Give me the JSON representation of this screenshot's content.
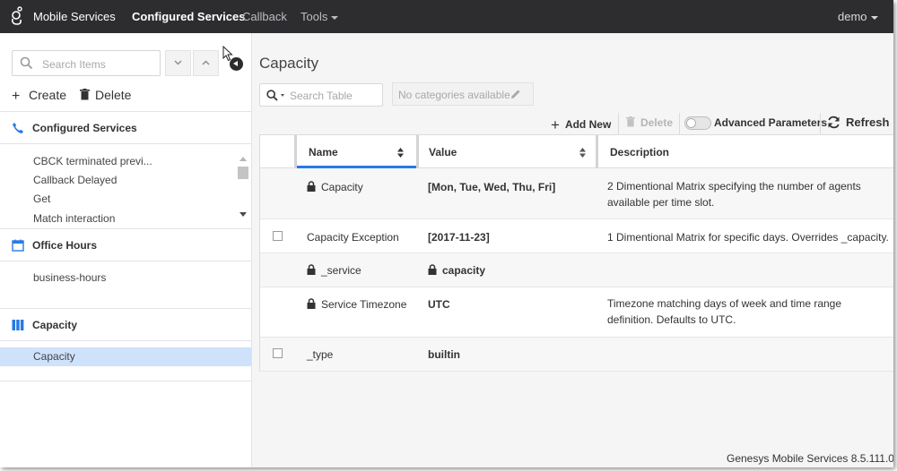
{
  "topnav": {
    "brand": "Mobile Services",
    "items": [
      {
        "label": "Configured Services"
      },
      {
        "label": "Callback"
      },
      {
        "label": "Tools"
      }
    ],
    "user": "demo"
  },
  "sidebar": {
    "search_placeholder": "Search Items",
    "create_label": "Create",
    "delete_label": "Delete",
    "sections": [
      {
        "title": "Configured Services",
        "icon": "phone-icon",
        "items": [
          "CBCK terminated previ...",
          "Callback Delayed",
          "Get",
          "Match interaction"
        ]
      },
      {
        "title": "Office Hours",
        "icon": "calendar-icon",
        "items": [
          "business-hours"
        ]
      },
      {
        "title": "Capacity",
        "icon": "columns-icon",
        "items": [
          "Capacity"
        ]
      }
    ],
    "selected_item": "Capacity"
  },
  "main": {
    "title": "Capacity",
    "table_search_placeholder": "Search Table",
    "categories_placeholder": "No categories available",
    "toolbar": {
      "add_new": "Add New",
      "delete": "Delete",
      "advanced_parameters": "Advanced Parameters",
      "refresh": "Refresh"
    },
    "columns": {
      "name": "Name",
      "value": "Value",
      "description": "Description"
    },
    "rows": [
      {
        "name": "Capacity",
        "locked": true,
        "value": "[Mon, Tue, Wed, Thu, Fri]",
        "value_locked": false,
        "description": "2 Dimentional Matrix specifying the number of agents available per time slot."
      },
      {
        "name": "Capacity Exception",
        "locked": false,
        "value": "[2017-11-23]",
        "value_locked": false,
        "description": "1 Dimentional Matrix for specific days. Overrides _capacity."
      },
      {
        "name": "_service",
        "locked": true,
        "value": "capacity",
        "value_locked": true,
        "description": ""
      },
      {
        "name": "Service Timezone",
        "locked": true,
        "value": "UTC",
        "value_locked": false,
        "description": "Timezone matching days of week and time range definition. Defaults to UTC."
      },
      {
        "name": "_type",
        "locked": false,
        "value": "builtin",
        "value_locked": false,
        "description": ""
      }
    ]
  },
  "footer": "Genesys Mobile Services 8.5.111.0",
  "colors": {
    "topbar": "#2d2d2f",
    "accent": "#2a7ae2",
    "selected": "#cfe2fc"
  }
}
